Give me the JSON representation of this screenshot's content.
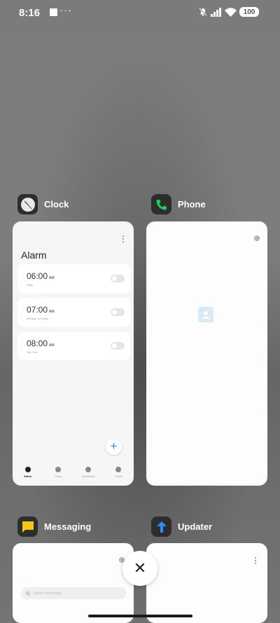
{
  "status_bar": {
    "time": "8:16",
    "overflow": "···",
    "battery": "100",
    "icons": [
      "notification-square-icon",
      "mute-icon",
      "signal-icon",
      "wifi-icon",
      "battery-icon"
    ]
  },
  "recent_apps": [
    {
      "name": "Clock",
      "icon": "clock-icon",
      "preview": {
        "title": "Alarm",
        "alarms": [
          {
            "time": "06:00",
            "ampm": "AM",
            "sub": "Daily",
            "enabled": false
          },
          {
            "time": "07:00",
            "ampm": "AM",
            "sub": "Monday to Friday",
            "enabled": false
          },
          {
            "time": "08:00",
            "ampm": "AM",
            "sub": "Sat, Sun",
            "enabled": false
          }
        ],
        "fab": "+",
        "tabs": [
          "Alarm",
          "Clock",
          "Stopwatch",
          "Timer"
        ],
        "active_tab": "Alarm"
      }
    },
    {
      "name": "Phone",
      "icon": "phone-icon",
      "accent": "#20c964"
    },
    {
      "name": "Messaging",
      "icon": "messaging-icon",
      "accent": "#f5c518",
      "preview": {
        "search_placeholder": "Search messages"
      }
    },
    {
      "name": "Updater",
      "icon": "updater-icon",
      "accent": "#2f8cff"
    }
  ],
  "close_all": "✕",
  "colors": {
    "fab_plus": "#3b7cd6"
  }
}
